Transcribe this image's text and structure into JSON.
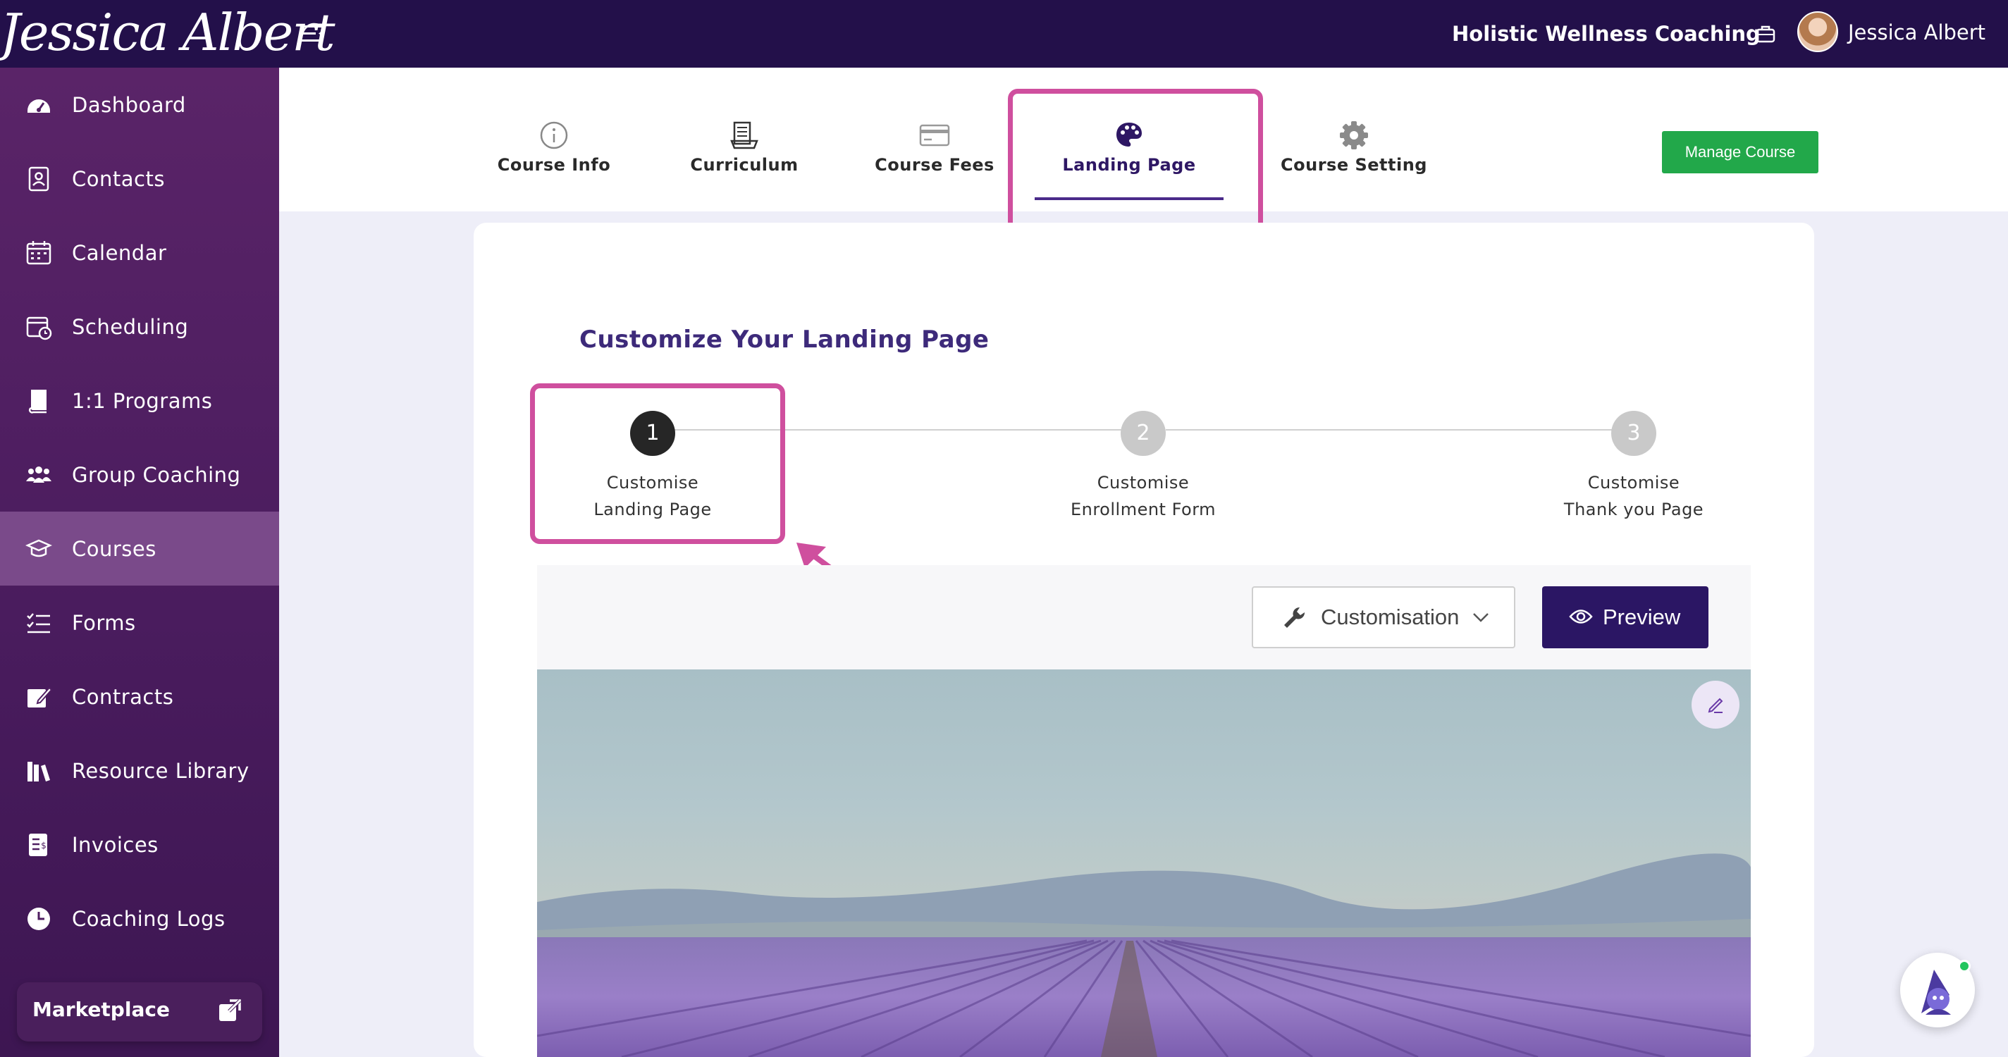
{
  "header": {
    "brand": "Jessica Albert",
    "org_name": "Holistic Wellness Coaching",
    "user_name": "Jessica Albert"
  },
  "sidebar": {
    "items": [
      {
        "label": "Dashboard",
        "icon": "dashboard-gauge-icon"
      },
      {
        "label": "Contacts",
        "icon": "contacts-icon"
      },
      {
        "label": "Calendar",
        "icon": "calendar-icon"
      },
      {
        "label": "Scheduling",
        "icon": "scheduling-icon"
      },
      {
        "label": "1:1 Programs",
        "icon": "book-icon"
      },
      {
        "label": "Group Coaching",
        "icon": "group-icon"
      },
      {
        "label": "Courses",
        "icon": "graduation-cap-icon",
        "active": true
      },
      {
        "label": "Forms",
        "icon": "forms-checklist-icon"
      },
      {
        "label": "Contracts",
        "icon": "contract-sign-icon"
      },
      {
        "label": "Resource Library",
        "icon": "library-icon"
      },
      {
        "label": "Invoices",
        "icon": "invoice-icon"
      },
      {
        "label": "Coaching Logs",
        "icon": "clock-icon"
      }
    ],
    "marketplace": "Marketplace"
  },
  "tabs": [
    {
      "label": "Course Info",
      "icon": "info-icon"
    },
    {
      "label": "Curriculum",
      "icon": "curriculum-icon"
    },
    {
      "label": "Course Fees",
      "icon": "credit-card-icon"
    },
    {
      "label": "Landing Page",
      "icon": "palette-icon",
      "active": true
    },
    {
      "label": "Course Setting",
      "icon": "gear-icon"
    }
  ],
  "manage_course": "Manage Course",
  "card": {
    "title": "Customize Your Landing Page",
    "steps": [
      {
        "number": "1",
        "line1": "Customise",
        "line2": "Landing Page",
        "state": "current"
      },
      {
        "number": "2",
        "line1": "Customise",
        "line2": "Enrollment Form",
        "state": "pending"
      },
      {
        "number": "3",
        "line1": "Customise",
        "line2": "Thank you Page",
        "state": "pending"
      }
    ],
    "customisation_label": "Customisation",
    "preview_label": "Preview"
  },
  "colors": {
    "topbar": "#23104a",
    "sidebar": "#4f1e61",
    "accent_purple": "#2b1664",
    "manage_green": "#22a84a",
    "highlight_pink": "#cf4f9e"
  }
}
